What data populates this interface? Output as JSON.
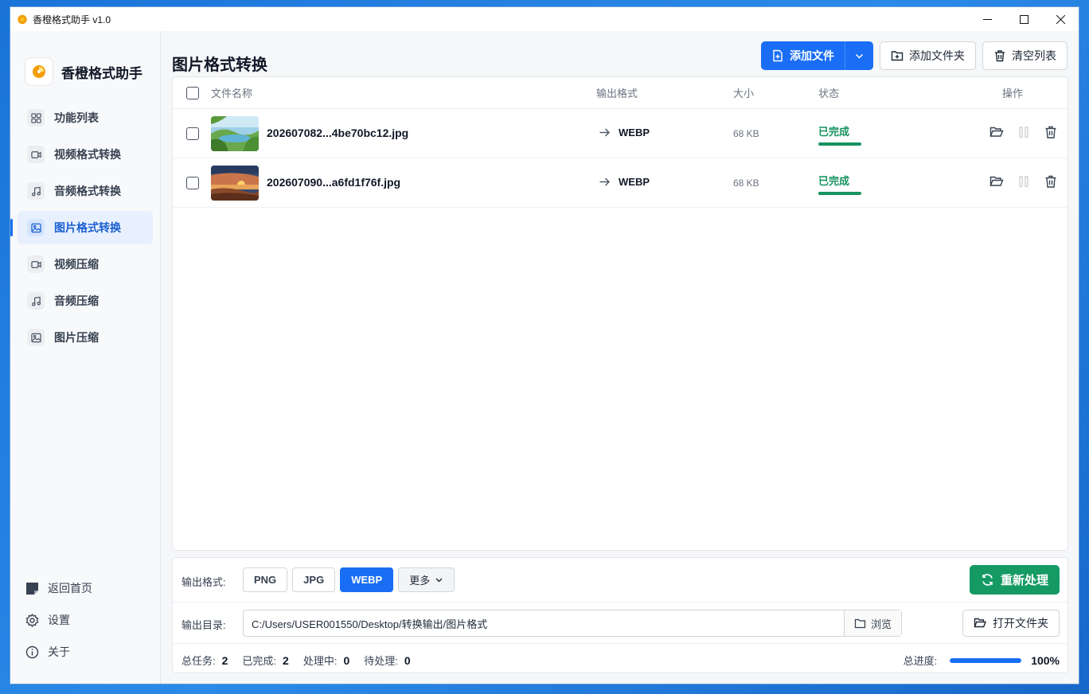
{
  "window": {
    "title": "香橙格式助手 v1.0"
  },
  "sidebar": {
    "brand": "香橙格式助手",
    "items": [
      {
        "label": "功能列表",
        "icon": "grid-icon"
      },
      {
        "label": "视频格式转换",
        "icon": "video-icon"
      },
      {
        "label": "音频格式转换",
        "icon": "music-icon"
      },
      {
        "label": "图片格式转换",
        "icon": "image-icon",
        "active": true
      },
      {
        "label": "视频压缩",
        "icon": "video-icon"
      },
      {
        "label": "音频压缩",
        "icon": "music-icon"
      },
      {
        "label": "图片压缩",
        "icon": "image-icon"
      }
    ],
    "bottom": {
      "home": "返回首页",
      "settings": "设置",
      "about": "关于"
    }
  },
  "main": {
    "title": "图片格式转换",
    "actions": {
      "add_file": "添加文件",
      "add_folder": "添加文件夹",
      "clear_list": "清空列表"
    },
    "table": {
      "headers": {
        "name": "文件名称",
        "format": "输出格式",
        "size": "大小",
        "status": "状态",
        "ops": "操作"
      },
      "rows": [
        {
          "name": "202607082...4be70bc12.jpg",
          "format": "WEBP",
          "size": "68 KB",
          "status": "已完成",
          "progress": 100,
          "thumb": "landscape-lake"
        },
        {
          "name": "202607090...a6fd1f76f.jpg",
          "format": "WEBP",
          "size": "68 KB",
          "status": "已完成",
          "progress": 100,
          "thumb": "sunset-coast"
        }
      ]
    },
    "output": {
      "format_label": "输出格式:",
      "formats": [
        "PNG",
        "JPG",
        "WEBP"
      ],
      "selected_format": "WEBP",
      "more": "更多",
      "reprocess": "重新处理",
      "dir_label": "输出目录:",
      "dir_path": "C:/Users/USER001550/Desktop/转换输出/图片格式",
      "browse": "浏览",
      "open_folder": "打开文件夹"
    },
    "stats": {
      "total_label": "总任务:",
      "total": "2",
      "done_label": "已完成:",
      "done": "2",
      "processing_label": "处理中:",
      "processing": "0",
      "pending_label": "待处理:",
      "pending": "0",
      "progress_label": "总进度:",
      "progress": "100%",
      "progress_value": 100
    }
  },
  "colors": {
    "accent": "#1a6ef5",
    "success": "#15935f",
    "brand_orange": "#f59e0b"
  }
}
